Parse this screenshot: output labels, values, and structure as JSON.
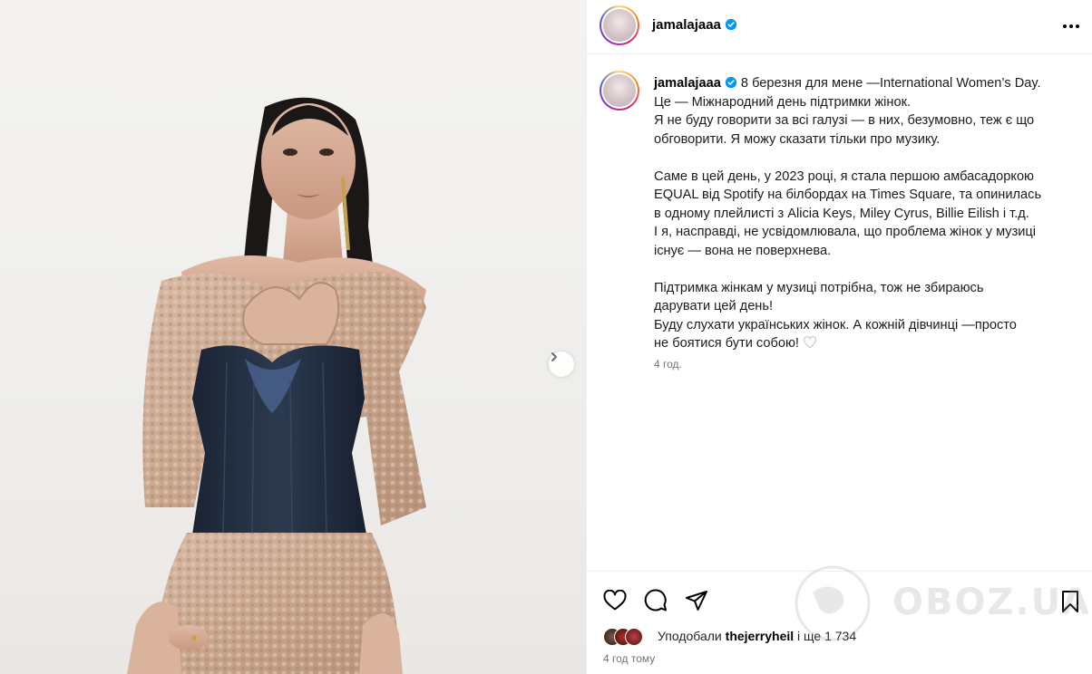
{
  "post": {
    "username": "jamalajaaa",
    "caption": [
      "8 березня для мене —International Women’s Day.",
      "Це — Міжнародний день підтримки жінок.",
      "Я не буду говорити за всі галузі — в них, безумовно, теж є що",
      "обговорити. Я можу сказати тільки про музику.",
      "",
      "Саме в цей день, у 2023 році, я стала першою амбасадоркою",
      "EQUAL від Spotify на білбордах на Times Square, та опинилась",
      "в одному плейлисті з Alicia Keys, Miley Cyrus, Billie Eilish і т.д.",
      "І я, насправді, не усвідомлювала, що проблема жінок у музиці",
      "існує — вона не поверхнева.",
      "",
      "Підтримка жінкам у музиці потрібна, тож не збираюсь",
      "дарувати цей день!",
      "Буду слухати українських жінок. А кожній дівчинці —просто",
      "не боятися бути собою! "
    ],
    "caption_time": "4 год.",
    "likes_prefix": "Уподобали",
    "likes_user": "thejerryheil",
    "likes_suffix": " і ще 1 734",
    "post_time": "4 год тому"
  },
  "icons": {
    "verified": "verified-badge-icon",
    "more": "more-options-icon",
    "like": "heart-icon",
    "comment": "comment-icon",
    "share": "share-icon",
    "save": "bookmark-icon",
    "next": "chevron-right-icon"
  },
  "watermark": {
    "text": "OBOZ.UA"
  },
  "colors": {
    "verified": "#0095f6",
    "text": "#262626",
    "muted": "#737373"
  }
}
